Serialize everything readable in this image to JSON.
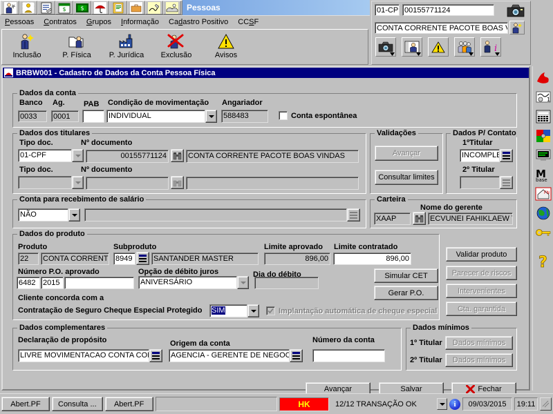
{
  "parent_window": {
    "title": "Pessoas",
    "icon_strip": [
      "person-settings-icon",
      "person-card-icon",
      "document-list-icon",
      "calendar-money-icon",
      "money-stack-icon",
      "umbrella-icon",
      "book-icon",
      "briefcase-icon",
      "signature-pen-icon",
      "handshake-icon"
    ],
    "menu": [
      {
        "label": "Pessoas",
        "accel": "P"
      },
      {
        "label": "Contratos",
        "accel": "C"
      },
      {
        "label": "Grupos",
        "accel": "G"
      },
      {
        "label": "Informação",
        "accel": "I"
      },
      {
        "label": "Cadastro Positivo",
        "accel": "d"
      },
      {
        "label": "CCSF",
        "accel": "S"
      }
    ],
    "toolbar": [
      {
        "label": "Inclusão",
        "icon": "person-add-icon"
      },
      {
        "label": "P. Física",
        "icon": "folder-person-icon"
      },
      {
        "label": "P. Jurídica",
        "icon": "factory-icon"
      },
      {
        "label": "Exclusão",
        "icon": "person-delete-icon"
      },
      {
        "label": "Avisos",
        "icon": "warning-triangle-icon"
      }
    ]
  },
  "header_panel": {
    "doc_type": "01-CPF",
    "doc_number": "00155771124",
    "client_name": "CONTA CORRENTE PACOTE BOAS VINDAS",
    "camera_icon": "camera-icon",
    "person_icon": "person-icon",
    "action_icons": [
      "camera-icon",
      "person-photo-icon",
      "warning-triangle-icon",
      "group-people-icon",
      "person-info-icon"
    ]
  },
  "child_window": {
    "icon": "app-icon",
    "title": "BRBW001 - Cadastro de Dados da Conta Pessoa Física"
  },
  "dados_conta": {
    "caption": "Dados da conta",
    "banco_label": "Banco",
    "banco_value": "0033",
    "ag_label": "Ag.",
    "ag_value": "0001",
    "pab_label": "PAB",
    "pab_value": "",
    "condicao_label": "Condição de movimentação",
    "condicao_value": "INDIVIDUAL",
    "angariador_label": "Angariador",
    "angariador_value": "588483",
    "conta_espontanea_label": "Conta espontânea",
    "conta_espontanea_checked": false
  },
  "dados_titulares": {
    "caption": "Dados dos titulares",
    "tipo_doc_label": "Tipo doc.",
    "num_doc_label": "Nº documento",
    "rows": [
      {
        "tipo_doc": "01-CPF",
        "num_doc": "00155771124",
        "nome": "CONTA CORRENTE PACOTE BOAS VINDAS",
        "enabled": true
      },
      {
        "tipo_doc": "",
        "num_doc": "",
        "nome": "",
        "enabled": false
      }
    ]
  },
  "validacoes": {
    "caption": "Validações",
    "avancar_label": "Avançar",
    "avancar_enabled": false,
    "consultar_limites_label": "Consultar limites",
    "consultar_limites_enabled": true
  },
  "dados_contato": {
    "caption": "Dados P/ Contato",
    "titular1_label": "1ºTitular",
    "titular1_value": "INCOMPLETO",
    "titular2_label": "2º Titular",
    "titular2_value": ""
  },
  "conta_salario": {
    "caption": "Conta para recebimento de salário",
    "value": "NÃO",
    "detail_value": ""
  },
  "carteira": {
    "caption": "Carteira",
    "codigo": "XAAP",
    "gerente_label": "Nome do gerente",
    "gerente_nome": "ECVUNEI FAHIKLAEW TA"
  },
  "dados_produto": {
    "caption": "Dados do produto",
    "produto_label": "Produto",
    "produto_codigo": "22",
    "produto_nome": "CONTA CORRENTE",
    "subproduto_label": "Subproduto",
    "subproduto_codigo": "8949",
    "subproduto_nome": "SANTANDER MASTER",
    "limite_aprovado_label": "Limite aprovado",
    "limite_aprovado_value": "896,00",
    "limite_contratado_label": "Limite contratado",
    "limite_contratado_value": "896,00",
    "po_label": "Número P.O. aprovado",
    "po_num": "6482",
    "po_ano": "2015",
    "po_extra": "",
    "opcao_debito_label": "Opção de débito juros",
    "opcao_debito_value": "ANIVERSÁRIO",
    "dia_debito_label": "Dia do débito",
    "dia_debito_value": "",
    "cliente_concorda_line1": "Cliente concorda com a",
    "cliente_concorda_line2": "Contratação de Seguro Cheque Especial Protegido",
    "seguro_value": "SIM",
    "implantacao_label": "Implantação automática de cheque especial",
    "implantacao_checked": true,
    "implantacao_enabled": false,
    "buttons": [
      {
        "label": "Validar produto",
        "enabled": true
      },
      {
        "label": "Simular CET",
        "enabled": true
      },
      {
        "label": "Parecer de riscos",
        "enabled": false
      },
      {
        "label": "Gerar P.O.",
        "enabled": true
      },
      {
        "label": "Intervenientes",
        "enabled": false
      },
      {
        "label": "Cta. garantida",
        "enabled": false
      }
    ]
  },
  "dados_complementares": {
    "caption": "Dados complementares",
    "declaracao_label": "Declaração de propósito",
    "declaracao_value": "LIVRE MOVIMENTACAO CONTA CORRENTE",
    "origem_label": "Origem da conta",
    "origem_value": "AGENCIA - GERENTE DE NEGOCIO",
    "numero_conta_label": "Número da conta",
    "numero_conta_value": ""
  },
  "dados_minimos": {
    "caption": "Dados mínimos",
    "titular1_label": "1º Titular",
    "titular1_btn": "Dados mínimos",
    "titular2_label": "2º Titular",
    "titular2_btn": "Dados mínimos",
    "enabled": false
  },
  "footer_buttons": [
    {
      "label": "Avançar",
      "name": "avancar-button"
    },
    {
      "label": "Salvar",
      "name": "salvar-button"
    },
    {
      "label": "Fechar",
      "name": "fechar-button",
      "icon": "red-x-icon"
    }
  ],
  "vtoolbar": [
    {
      "icon": "santander-flame-icon"
    },
    {
      "icon": "signature-card-icon"
    },
    {
      "icon": "calculator-icon"
    },
    {
      "icon": "puzzle-icon"
    },
    {
      "icon": "monitor-terminal-icon"
    },
    {
      "icon": "mbase-logo-icon"
    },
    {
      "icon": "house-fn-icon"
    },
    {
      "icon": "globe-icon"
    },
    {
      "icon": "key-icon"
    },
    {
      "icon": "help-question-icon"
    }
  ],
  "statusbar": {
    "tabs": [
      "Abert.PF",
      "Consulta ...",
      "Abert.PF"
    ],
    "hk_label": "HK",
    "message": "12/12 TRANSAÇÃO  OK",
    "info_icon": "info-icon",
    "date": "09/03/2015",
    "time": "19:11"
  },
  "colors": {
    "titlebar_active": "#0a246a",
    "child_titlebar": "#000080",
    "face": "#c0c0c0",
    "hk_bg": "#ff0000",
    "hk_fg": "#ffff00",
    "selection": "#000080"
  }
}
